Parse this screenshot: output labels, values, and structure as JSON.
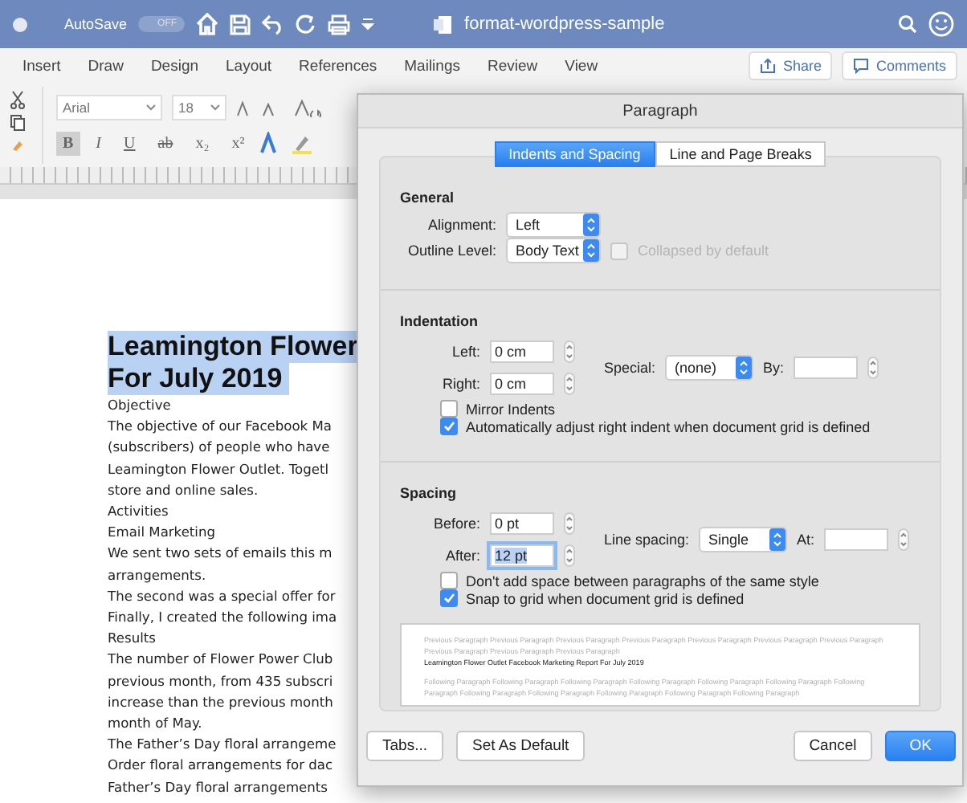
{
  "titlebar": {
    "autosave_label": "AutoSave",
    "autosave_toggle": "OFF",
    "autosave_on": false,
    "document_title": "format-wordpress-sample"
  },
  "ribbon_tabs": [
    {
      "label": "Insert",
      "selected": false
    },
    {
      "label": "Draw",
      "selected": false
    },
    {
      "label": "Design",
      "selected": false
    },
    {
      "label": "Layout",
      "selected": false
    },
    {
      "label": "References",
      "selected": false
    },
    {
      "label": "Mailings",
      "selected": false
    },
    {
      "label": "Review",
      "selected": false
    },
    {
      "label": "View",
      "selected": false
    }
  ],
  "ribbon_actions": [
    {
      "label": "Share",
      "kind": "share"
    },
    {
      "label": "Comments",
      "kind": "comments"
    }
  ],
  "toolbar": {
    "font": "Arial",
    "size": "18",
    "format_buttons": [
      {
        "label": "B",
        "kind": "bold",
        "on": true
      },
      {
        "label": "I",
        "kind": "italic",
        "on": false
      },
      {
        "label": "U",
        "kind": "underline",
        "on": false
      },
      {
        "label": "ab",
        "kind": "strike",
        "on": false
      },
      {
        "label": "x₂",
        "kind": "sub",
        "on": false
      },
      {
        "label": "x²",
        "kind": "sup",
        "on": false
      }
    ]
  },
  "document": {
    "heading": [
      "Leamington Flower",
      "For July 2019"
    ],
    "lines": [
      "Objective",
      "The objective of our Facebook Ma",
      "(subscribers) of people who have",
      "Leamington Flower Outlet. Togetl",
      "store and online sales.",
      "Activities",
      "Email Marketing",
      "We sent two sets of emails this m",
      "arrangements.",
      "The second was a special offer for",
      "Finally, I created the following ima",
      "Results",
      "The number of Flower Power Club",
      "previous month, from 435 subscri",
      "increase than the previous month",
      "month of May.",
      "The Father’s Day floral arrangeme",
      "Order floral arrangements for dac",
      "Father’s Day floral arrangements"
    ]
  },
  "dialog": {
    "title": "Paragraph",
    "tabs": [
      {
        "label": "Indents and Spacing",
        "selected": true
      },
      {
        "label": "Line and Page Breaks",
        "selected": false
      }
    ],
    "general": {
      "heading": "General",
      "alignment_label": "Alignment:",
      "alignment": "Left",
      "outline_label": "Outline Level:",
      "outline": "Body Text",
      "collapsed_label": "Collapsed by default",
      "collapsed_checked": false,
      "collapsed_disabled": true
    },
    "indentation": {
      "heading": "Indentation",
      "left_label": "Left:",
      "left": "0 cm",
      "right_label": "Right:",
      "right": "0 cm",
      "special_label": "Special:",
      "special": "(none)",
      "by_label": "By:",
      "options": [
        {
          "label": "Mirror Indents",
          "checked": false
        },
        {
          "label": "Automatically adjust right indent when document grid is defined",
          "checked": true
        }
      ]
    },
    "spacing": {
      "heading": "Spacing",
      "before_label": "Before:",
      "before": "0 pt",
      "after_label": "After:",
      "after": "12 pt",
      "line_label": "Line spacing:",
      "line": "Single",
      "at_label": "At:",
      "options": [
        {
          "label": "Don't add space between paragraphs of the same style",
          "checked": false
        },
        {
          "label": "Snap to grid when document grid is defined",
          "checked": true
        }
      ]
    },
    "preview": {
      "previous": "Previous Paragraph Previous Paragraph Previous Paragraph Previous Paragraph Previous Paragraph Previous Paragraph Previous Paragraph Previous Paragraph Previous Paragraph Previous Paragraph",
      "current": "Leamington Flower Outlet Facebook Marketing Report For July 2019",
      "following": "Following Paragraph Following Paragraph Following Paragraph Following Paragraph Following Paragraph Following Paragraph Following Paragraph Following Paragraph Following Paragraph Following Paragraph Following Paragraph Following Paragraph"
    },
    "buttons": [
      {
        "label": "Tabs...",
        "kind": "plain"
      },
      {
        "label": "Set As Default",
        "kind": "plain"
      },
      {
        "label": "Cancel",
        "kind": "plain"
      },
      {
        "label": "OK",
        "kind": "default"
      }
    ]
  }
}
